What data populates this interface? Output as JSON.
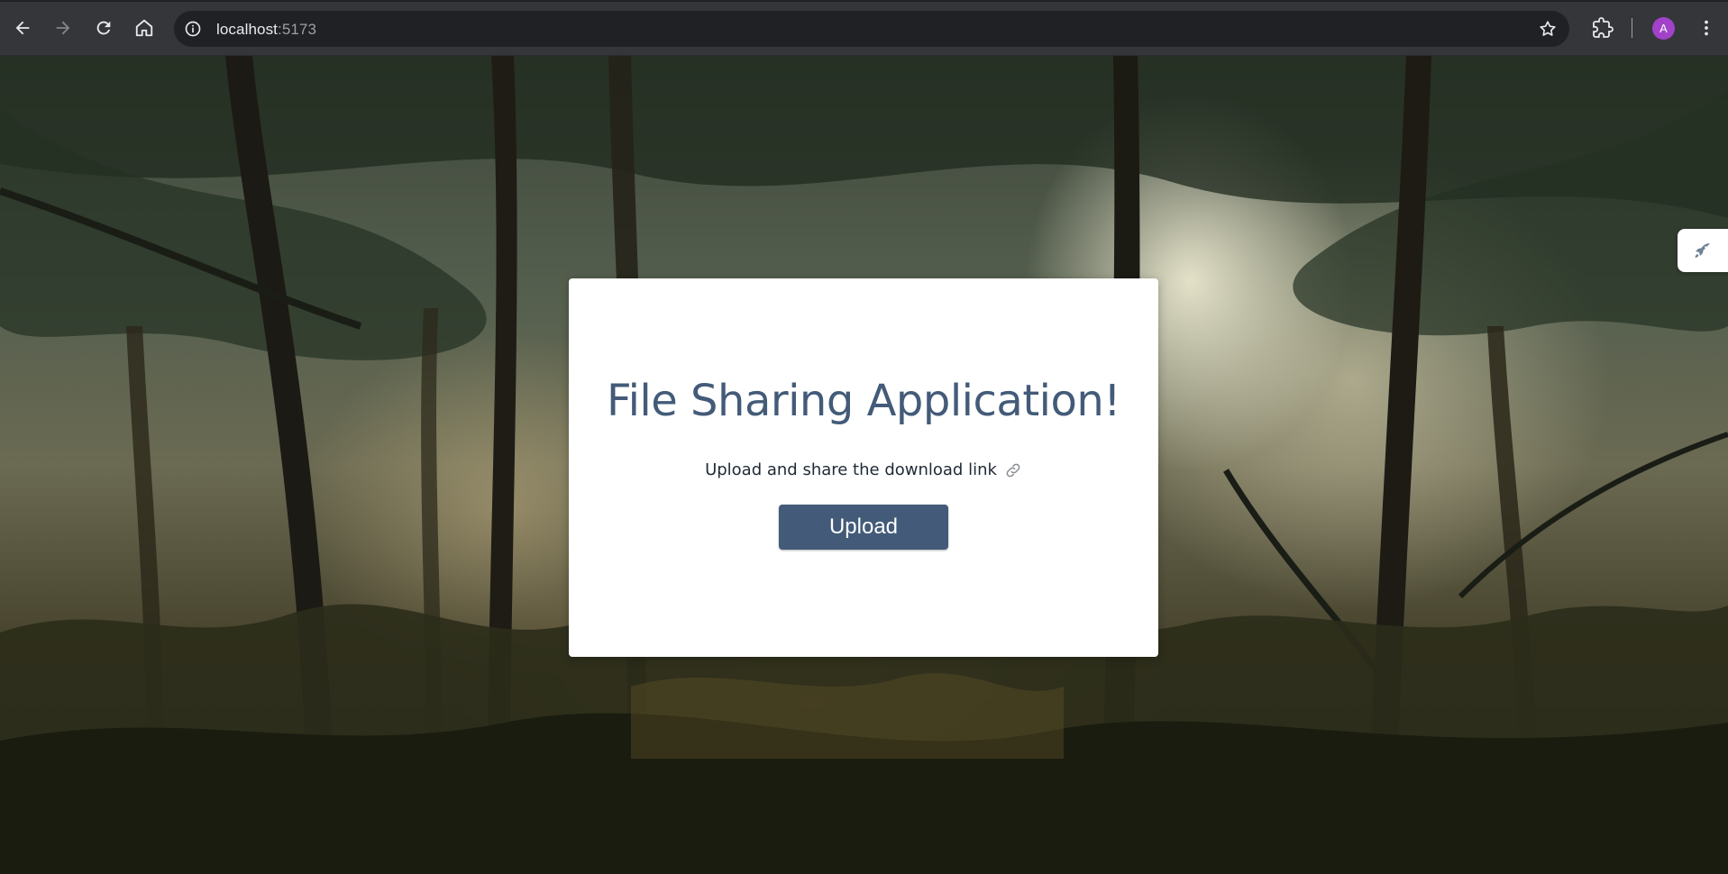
{
  "browser": {
    "url_host": "localhost",
    "url_port": ":5173",
    "profile_initial": "A",
    "nav": {
      "back_icon": "back-arrow-icon",
      "forward_icon": "forward-arrow-icon",
      "reload_icon": "reload-icon",
      "home_icon": "home-icon"
    }
  },
  "page": {
    "title": "File Sharing Application!",
    "subtitle": "Upload and share the download link",
    "subtitle_icon": "link-icon",
    "upload_label": "Upload",
    "side_widget_icon": "rocket-icon"
  },
  "colors": {
    "accent": "#435b78",
    "card_bg": "#ffffff",
    "avatar": "#a142c9",
    "chrome_bg": "#35363a"
  }
}
